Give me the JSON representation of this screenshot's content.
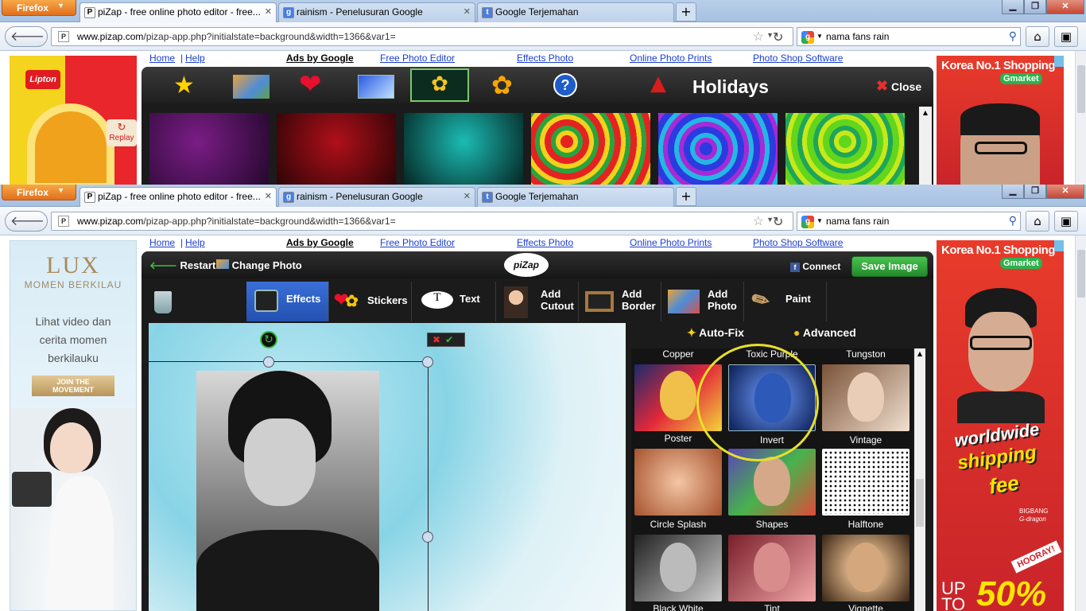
{
  "browser": {
    "app_button": "Firefox",
    "tabs": [
      {
        "title": "piZap - free online photo editor - free...",
        "favicon": "P"
      },
      {
        "title": "rainism - Penelusuran Google",
        "favicon": "g"
      },
      {
        "title": "Google Terjemahan",
        "favicon": "t"
      }
    ],
    "url_host": "www.pizap.com",
    "url_path": "/pizap-app.php?initialstate=background&width=1366&var1=",
    "search_text": "nama fans rain"
  },
  "site_nav": {
    "home": "Home",
    "help": "Help",
    "ads_by_google": "Ads by Google",
    "links": [
      "Free Photo Editor",
      "Effects Photo",
      "Online Photo Prints",
      "Photo Shop Software"
    ]
  },
  "ad_left_top": {
    "brand": "Lipton",
    "replay": "Replay"
  },
  "ad_left_bottom": {
    "brand": "LUX",
    "tagline": "MOMEN BERKILAU",
    "body": "Lihat video dan cerita momen berkilauku",
    "cta": "JOIN THE MOVEMENT"
  },
  "ad_right": {
    "headline": "Korea No.1 Shopping",
    "brand": "Gmarket",
    "promo1": "worldwide",
    "promo2": "shipping",
    "promo3": "fee",
    "credit1": "BIGBANG",
    "credit2": "G-dragon",
    "hooray": "HOORAY!",
    "up_to": "UP TO",
    "discount": "50%"
  },
  "bg_panel": {
    "category": "Holidays",
    "close": "Close"
  },
  "editor": {
    "restart": "Restart",
    "change_photo": "Change Photo",
    "logo": "piZap",
    "connect": "Connect",
    "save": "Save Image",
    "tools": [
      {
        "label": "Effects"
      },
      {
        "label": "Stickers"
      },
      {
        "label": "Text"
      },
      {
        "label": "Add Cutout"
      },
      {
        "label": "Add Border"
      },
      {
        "label": "Add Photo"
      },
      {
        "label": "Paint"
      }
    ],
    "autofix": "Auto-Fix",
    "advanced": "Advanced",
    "effect_row_top": [
      "Copper",
      "Toxic Purple",
      "Tungston"
    ],
    "effects": [
      {
        "label": "Poster"
      },
      {
        "label": "Invert"
      },
      {
        "label": "Vintage"
      },
      {
        "label": "Circle Splash"
      },
      {
        "label": "Shapes"
      },
      {
        "label": "Halftone"
      },
      {
        "label": "Black White"
      },
      {
        "label": "Tint"
      },
      {
        "label": "Vignette"
      }
    ]
  },
  "colors": {
    "tab_blue": "#b9cfe9",
    "link_blue": "#1a3fd1",
    "editor_dark": "#1b1b1b",
    "effects_active": "#2b5bc4",
    "save_green": "#2ea83a",
    "highlight_yellow": "#e6e02a"
  }
}
